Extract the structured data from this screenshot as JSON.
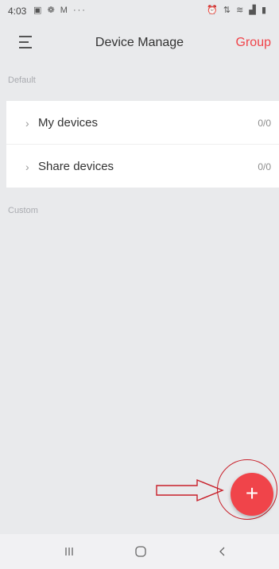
{
  "status_bar": {
    "time": "4:03",
    "left_icons": [
      "image-icon",
      "settings-icon",
      "mail-icon",
      "more-dots-icon"
    ],
    "right_icons": [
      "alarm-icon",
      "network-icon",
      "wifi-icon",
      "signal-icon",
      "battery-icon"
    ]
  },
  "header": {
    "title": "Device Manage",
    "action_label": "Group",
    "accent_color": "#f0444a"
  },
  "sections": {
    "default_label": "Default",
    "custom_label": "Custom"
  },
  "device_list": [
    {
      "label": "My devices",
      "count": "0/0"
    },
    {
      "label": "Share devices",
      "count": "0/0"
    }
  ],
  "fab": {
    "icon": "plus-icon",
    "symbol": "+"
  },
  "nav_bar": {
    "buttons": [
      "recents-icon",
      "home-icon",
      "back-icon"
    ]
  }
}
